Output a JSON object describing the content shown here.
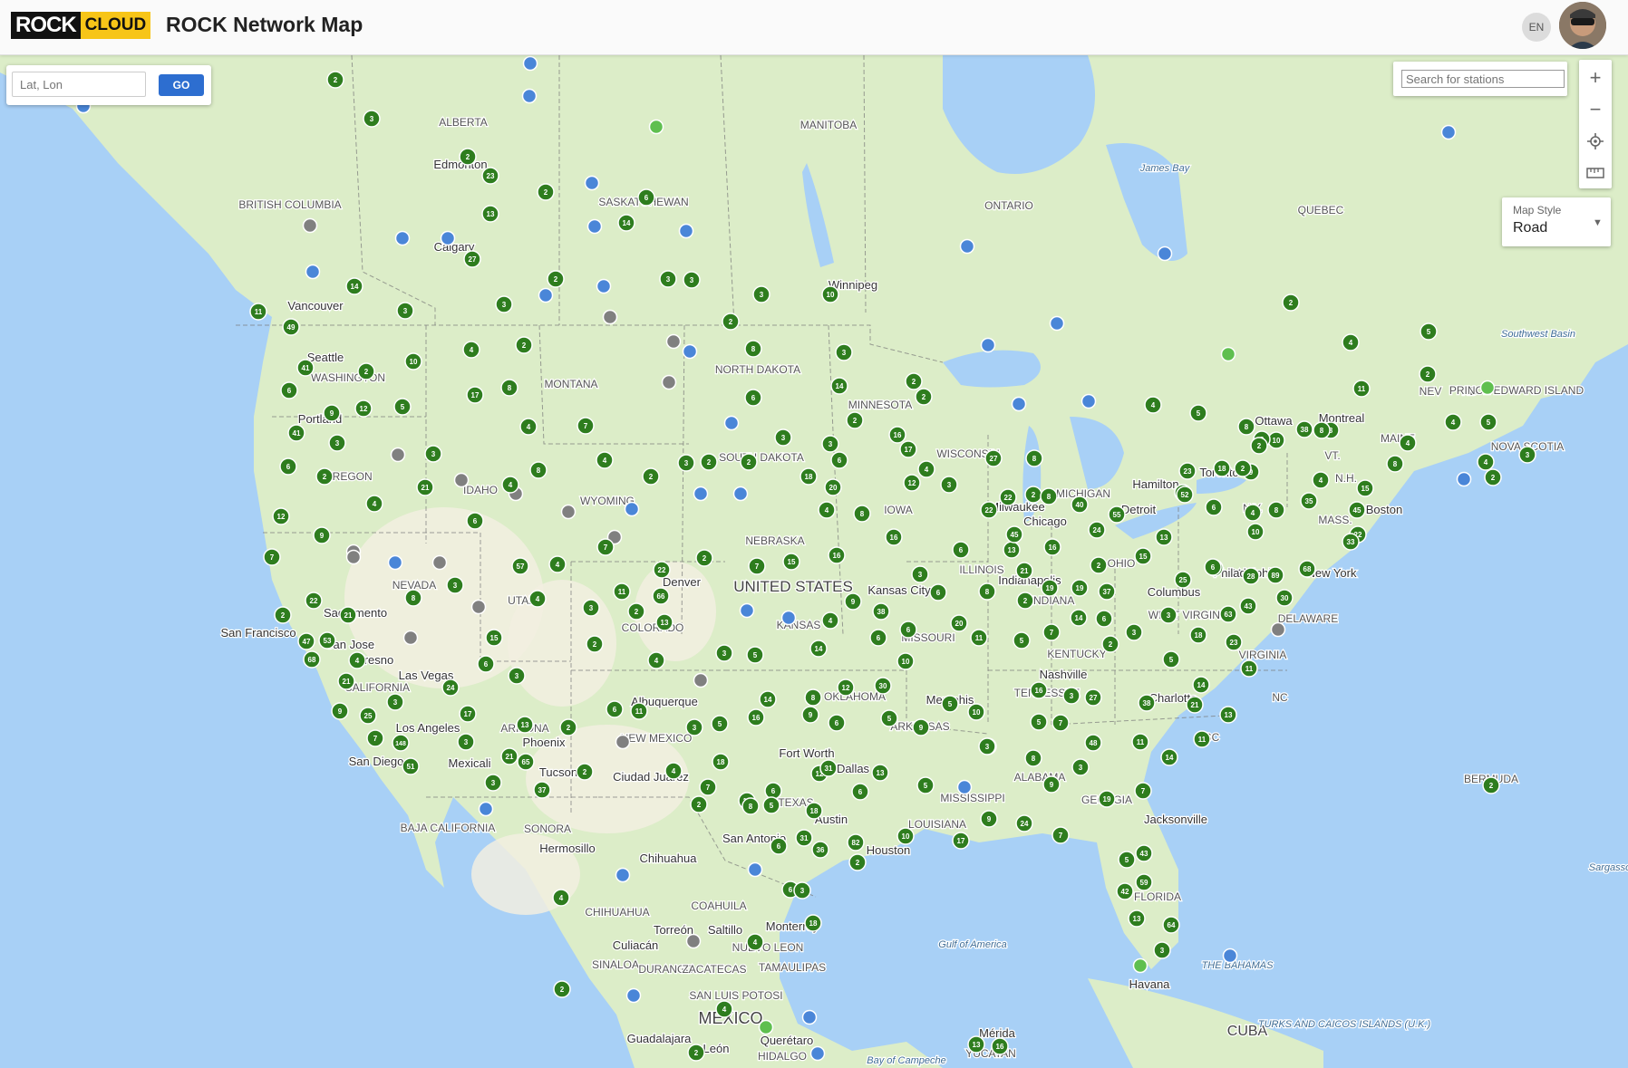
{
  "header": {
    "logo_rock": "ROCK",
    "logo_cloud": "CLOUD",
    "title": "ROCK Network Map",
    "lang": "EN"
  },
  "latlon": {
    "placeholder": "Lat, Lon",
    "go_label": "GO"
  },
  "search": {
    "placeholder": "Search for stations"
  },
  "zoom": {
    "in_label": "+",
    "out_label": "−"
  },
  "map_style": {
    "label": "Map Style",
    "value": "Road"
  },
  "colors": {
    "land": "#dcedc8",
    "land_dark": "#c8e6b0",
    "desert": "#f2efe0",
    "water": "#a8d0f6",
    "cluster": "#2e7d1e",
    "station_blue": "#4a86d8",
    "station_gray": "#808080",
    "station_green": "#5fbf4f"
  },
  "labels": {
    "countries": [
      "UNITED STATES",
      "MEXICO",
      "CUBA"
    ],
    "provinces": [
      "ALBERTA",
      "MANITOBA",
      "SASKATCHEWAN",
      "BRITISH COLUMBIA",
      "ONTARIO",
      "QUEBEC",
      "NB",
      "NEV",
      "PRINCE EDWARD ISLAND",
      "NOVA SCOTIA",
      "WASHINGTON",
      "MONTANA",
      "NORTH DAKOTA",
      "MINNESOTA",
      "OREGON",
      "IDAHO",
      "WYOMING",
      "SOUTH DAKOTA",
      "NEBRASKA",
      "IOWA",
      "WISCONSIN",
      "MICHIGAN",
      "ILLINOIS",
      "INDIANA",
      "OHIO",
      "NEVADA",
      "UTAH",
      "COLORADO",
      "KANSAS",
      "MISSOURI",
      "CALIFORNIA",
      "ARIZONA",
      "NEW MEXICO",
      "OKLAHOMA",
      "ARKANSAS",
      "TENNESSEE",
      "KENTUCKY",
      "VIRGINIA",
      "WEST VIRGINIA",
      "NC",
      "SC",
      "GEORGIA",
      "ALABAMA",
      "MISSISSIPPI",
      "LOUISIANA",
      "TEXAS",
      "FLORIDA",
      "N.Y.",
      "PA",
      "VT.",
      "N.H.",
      "MASS.",
      "MAINE",
      "DELAWARE",
      "BAJA CALIFORNIA",
      "SONORA",
      "CHIHUAHUA",
      "COAHUILA",
      "SINALOA",
      "DURANGO",
      "ZACATECAS",
      "NUEVO LEON",
      "TAMAULIPAS",
      "SAN LUIS POTOSI",
      "HIDALGO",
      "YUCATAN",
      "BERMUDA"
    ],
    "cities": [
      "Edmonton",
      "Calgary",
      "Vancouver",
      "Seattle",
      "Portland",
      "Winnipeg",
      "Ottawa",
      "Montreal",
      "Toronto",
      "Hamilton",
      "Boston",
      "New York",
      "Philadelphia",
      "Chicago",
      "Milwaukee",
      "Detroit",
      "Columbus",
      "Indianapolis",
      "Kansas City",
      "Denver",
      "Nashville",
      "Charlotte",
      "Memphis",
      "Dallas",
      "Fort Worth",
      "Austin",
      "San Antonio",
      "Houston",
      "Jacksonville",
      "Havana",
      "San Francisco",
      "San Jose",
      "Sacramento",
      "Fresno",
      "Las Vegas",
      "Los Angeles",
      "San Diego",
      "Mexicali",
      "Phoenix",
      "Tucson",
      "Albuquerque",
      "Ciudad Juárez",
      "Hermosillo",
      "Chihuahua",
      "Torreón",
      "Culiacán",
      "Saltillo",
      "Monterrey",
      "Querétaro",
      "Guadalajara",
      "León",
      "Mérida"
    ],
    "water": [
      "James Bay",
      "Gulf of America",
      "Bay of Campeche",
      "THE BAHAMAS",
      "TURKS AND CAICOS ISLANDS (U.K.)",
      "Southwest Basin",
      "Sargasso"
    ]
  },
  "clusters": [
    [
      "2",
      370,
      88
    ],
    [
      "3",
      410,
      131
    ],
    [
      "2",
      516,
      173
    ],
    [
      "23",
      541,
      194
    ],
    [
      "13",
      541,
      236
    ],
    [
      "2",
      602,
      212
    ],
    [
      "6",
      713,
      218
    ],
    [
      "14",
      691,
      246
    ],
    [
      "27",
      521,
      286
    ],
    [
      "14",
      391,
      316
    ],
    [
      "11",
      285,
      344
    ],
    [
      "3",
      447,
      343
    ],
    [
      "3",
      556,
      336
    ],
    [
      "2",
      613,
      308
    ],
    [
      "3",
      737,
      308
    ],
    [
      "3",
      763,
      309
    ],
    [
      "3",
      840,
      325
    ],
    [
      "10",
      916,
      325
    ],
    [
      "49",
      321,
      361
    ],
    [
      "41",
      337,
      406
    ],
    [
      "2",
      404,
      410
    ],
    [
      "6",
      319,
      431
    ],
    [
      "10",
      456,
      399
    ],
    [
      "4",
      520,
      386
    ],
    [
      "17",
      524,
      436
    ],
    [
      "8",
      562,
      428
    ],
    [
      "2",
      806,
      355
    ],
    [
      "8",
      831,
      385
    ],
    [
      "3",
      931,
      389
    ],
    [
      "2",
      578,
      381
    ],
    [
      "4",
      583,
      471
    ],
    [
      "7",
      646,
      470
    ],
    [
      "6",
      831,
      439
    ],
    [
      "14",
      926,
      426
    ],
    [
      "2",
      1008,
      421
    ],
    [
      "2",
      1019,
      438
    ],
    [
      "2",
      943,
      464
    ],
    [
      "16",
      990,
      480
    ],
    [
      "17",
      1002,
      496
    ],
    [
      "12",
      1006,
      533
    ],
    [
      "3",
      1047,
      535
    ],
    [
      "4",
      1022,
      518
    ],
    [
      "5",
      444,
      449
    ],
    [
      "12",
      401,
      451
    ],
    [
      "9",
      366,
      456
    ],
    [
      "41",
      327,
      478
    ],
    [
      "3",
      372,
      489
    ],
    [
      "3",
      478,
      501
    ],
    [
      "6",
      318,
      515
    ],
    [
      "2",
      358,
      526
    ],
    [
      "21",
      469,
      538
    ],
    [
      "4",
      413,
      556
    ],
    [
      "4",
      563,
      535
    ],
    [
      "8",
      594,
      519
    ],
    [
      "6",
      524,
      575
    ],
    [
      "2",
      718,
      526
    ],
    [
      "7",
      668,
      604
    ],
    [
      "4",
      667,
      508
    ],
    [
      "3",
      757,
      511
    ],
    [
      "2",
      782,
      510
    ],
    [
      "2",
      826,
      510
    ],
    [
      "3",
      864,
      483
    ],
    [
      "18",
      892,
      526
    ],
    [
      "3",
      916,
      490
    ],
    [
      "6",
      926,
      508
    ],
    [
      "20",
      919,
      538
    ],
    [
      "4",
      912,
      563
    ],
    [
      "8",
      951,
      567
    ],
    [
      "16",
      986,
      593
    ],
    [
      "12",
      310,
      570
    ],
    [
      "9",
      355,
      591
    ],
    [
      "7",
      300,
      615
    ],
    [
      "57",
      574,
      625
    ],
    [
      "4",
      615,
      623
    ],
    [
      "3",
      502,
      646
    ],
    [
      "8",
      456,
      660
    ],
    [
      "2",
      312,
      679
    ],
    [
      "22",
      346,
      663
    ],
    [
      "21",
      384,
      679
    ],
    [
      "53",
      361,
      707
    ],
    [
      "47",
      338,
      708
    ],
    [
      "68",
      344,
      728
    ],
    [
      "4",
      394,
      729
    ],
    [
      "21",
      382,
      752
    ],
    [
      "3",
      436,
      775
    ],
    [
      "9",
      375,
      785
    ],
    [
      "25",
      406,
      790
    ],
    [
      "7",
      414,
      815
    ],
    [
      "148",
      442,
      820
    ],
    [
      "51",
      453,
      846
    ],
    [
      "4",
      593,
      661
    ],
    [
      "3",
      652,
      671
    ],
    [
      "22",
      730,
      629
    ],
    [
      "11",
      686,
      653
    ],
    [
      "66",
      729,
      658
    ],
    [
      "2",
      702,
      675
    ],
    [
      "13",
      733,
      687
    ],
    [
      "15",
      545,
      704
    ],
    [
      "6",
      536,
      733
    ],
    [
      "2",
      656,
      711
    ],
    [
      "3",
      570,
      746
    ],
    [
      "4",
      724,
      729
    ],
    [
      "2",
      777,
      616
    ],
    [
      "7",
      835,
      625
    ],
    [
      "15",
      873,
      620
    ],
    [
      "16",
      923,
      613
    ],
    [
      "3",
      1015,
      634
    ],
    [
      "6",
      1035,
      654
    ],
    [
      "9",
      941,
      664
    ],
    [
      "38",
      972,
      675
    ],
    [
      "4",
      916,
      685
    ],
    [
      "6",
      1002,
      695
    ],
    [
      "6",
      969,
      704
    ],
    [
      "14",
      903,
      716
    ],
    [
      "10",
      999,
      730
    ],
    [
      "20",
      1058,
      688
    ],
    [
      "11",
      1080,
      704
    ],
    [
      "3",
      799,
      721
    ],
    [
      "5",
      833,
      723
    ],
    [
      "24",
      497,
      759
    ],
    [
      "17",
      516,
      788
    ],
    [
      "13",
      579,
      800
    ],
    [
      "6",
      678,
      783
    ],
    [
      "11",
      705,
      785
    ],
    [
      "2",
      627,
      803
    ],
    [
      "21",
      562,
      835
    ],
    [
      "65",
      580,
      841
    ],
    [
      "3",
      514,
      819
    ],
    [
      "3",
      544,
      864
    ],
    [
      "37",
      598,
      872
    ],
    [
      "2",
      645,
      852
    ],
    [
      "4",
      743,
      851
    ],
    [
      "7",
      781,
      869
    ],
    [
      "18",
      795,
      841
    ],
    [
      "2",
      771,
      888
    ],
    [
      "14",
      847,
      772
    ],
    [
      "16",
      834,
      792
    ],
    [
      "8",
      897,
      770
    ],
    [
      "12",
      933,
      759
    ],
    [
      "9",
      894,
      789
    ],
    [
      "6",
      923,
      798
    ],
    [
      "30",
      974,
      757
    ],
    [
      "5",
      1048,
      777
    ],
    [
      "5",
      981,
      793
    ],
    [
      "9",
      1016,
      803
    ],
    [
      "10",
      1077,
      786
    ],
    [
      "3",
      1090,
      824
    ],
    [
      "5",
      794,
      799
    ],
    [
      "3",
      766,
      803
    ],
    [
      "12",
      824,
      884
    ],
    [
      "6",
      853,
      873
    ],
    [
      "5",
      851,
      889
    ],
    [
      "12",
      904,
      854
    ],
    [
      "31",
      914,
      848
    ],
    [
      "18",
      898,
      895
    ],
    [
      "13",
      971,
      853
    ],
    [
      "6",
      949,
      874
    ],
    [
      "5",
      1021,
      867
    ],
    [
      "2",
      1140,
      546
    ],
    [
      "8",
      1141,
      506
    ],
    [
      "27",
      1096,
      506
    ],
    [
      "22",
      1112,
      549
    ],
    [
      "8",
      1157,
      548
    ],
    [
      "13",
      1116,
      607
    ],
    [
      "45",
      1119,
      590
    ],
    [
      "22",
      1091,
      563
    ],
    [
      "6",
      1060,
      607
    ],
    [
      "8",
      1089,
      653
    ],
    [
      "21",
      1130,
      630
    ],
    [
      "2",
      1131,
      663
    ],
    [
      "19",
      1158,
      649
    ],
    [
      "19",
      1191,
      649
    ],
    [
      "40",
      1191,
      557
    ],
    [
      "55",
      1232,
      568
    ],
    [
      "24",
      1210,
      585
    ],
    [
      "16",
      1161,
      604
    ],
    [
      "13",
      1284,
      593
    ],
    [
      "15",
      1261,
      614
    ],
    [
      "2",
      1212,
      624
    ],
    [
      "37",
      1221,
      653
    ],
    [
      "25",
      1305,
      640
    ],
    [
      "8",
      1340,
      627
    ],
    [
      "28",
      1380,
      636
    ],
    [
      "89",
      1407,
      635
    ],
    [
      "6",
      1218,
      683
    ],
    [
      "7",
      1160,
      698
    ],
    [
      "5",
      1127,
      707
    ],
    [
      "14",
      1190,
      682
    ],
    [
      "2",
      1225,
      711
    ],
    [
      "3",
      1251,
      698
    ],
    [
      "3",
      1289,
      679
    ],
    [
      "18",
      1322,
      701
    ],
    [
      "23",
      1361,
      709
    ],
    [
      "63",
      1355,
      678
    ],
    [
      "43",
      1377,
      669
    ],
    [
      "30",
      1417,
      660
    ],
    [
      "68",
      1442,
      628
    ],
    [
      "5",
      1292,
      728
    ],
    [
      "11",
      1378,
      738
    ],
    [
      "16",
      1146,
      762
    ],
    [
      "3",
      1182,
      768
    ],
    [
      "27",
      1206,
      770
    ],
    [
      "38",
      1265,
      776
    ],
    [
      "21",
      1318,
      778
    ],
    [
      "14",
      1325,
      756
    ],
    [
      "13",
      1355,
      789
    ],
    [
      "11",
      1258,
      819
    ],
    [
      "11",
      1326,
      816
    ],
    [
      "14",
      1290,
      836
    ],
    [
      "5",
      1146,
      797
    ],
    [
      "7",
      1170,
      798
    ],
    [
      "48",
      1206,
      820
    ],
    [
      "8",
      1140,
      837
    ],
    [
      "3",
      1089,
      824
    ],
    [
      "9",
      1160,
      866
    ],
    [
      "3",
      1192,
      847
    ],
    [
      "7",
      1261,
      873
    ],
    [
      "19",
      1221,
      882
    ],
    [
      "9",
      1091,
      904
    ],
    [
      "24",
      1130,
      909
    ],
    [
      "7",
      1170,
      922
    ],
    [
      "17",
      1060,
      928
    ],
    [
      "10",
      999,
      923
    ],
    [
      "8",
      828,
      890
    ],
    [
      "36",
      905,
      938
    ],
    [
      "82",
      944,
      930
    ],
    [
      "2",
      946,
      952
    ],
    [
      "31",
      887,
      925
    ],
    [
      "6",
      859,
      934
    ],
    [
      "6",
      872,
      982
    ],
    [
      "3",
      885,
      983
    ],
    [
      "18",
      897,
      1019
    ],
    [
      "4",
      833,
      1040
    ],
    [
      "4",
      619,
      991
    ],
    [
      "2",
      620,
      1092
    ],
    [
      "4",
      799,
      1114
    ],
    [
      "2",
      768,
      1162
    ],
    [
      "13",
      1077,
      1153
    ],
    [
      "16",
      1103,
      1155
    ],
    [
      "43",
      1262,
      942
    ],
    [
      "59",
      1262,
      974
    ],
    [
      "42",
      1241,
      984
    ],
    [
      "13",
      1254,
      1014
    ],
    [
      "64",
      1292,
      1021
    ],
    [
      "5",
      1243,
      949
    ],
    [
      "3",
      1282,
      1049
    ],
    [
      "2",
      1645,
      867
    ],
    [
      "22",
      1498,
      590
    ],
    [
      "33",
      1490,
      598
    ],
    [
      "45",
      1497,
      563
    ],
    [
      "35",
      1444,
      553
    ],
    [
      "15",
      1506,
      539
    ],
    [
      "4",
      1457,
      530
    ],
    [
      "8",
      1408,
      563
    ],
    [
      "10",
      1385,
      587
    ],
    [
      "4",
      1382,
      566
    ],
    [
      "6",
      1339,
      560
    ],
    [
      "13",
      1305,
      544
    ],
    [
      "52",
      1307,
      546
    ],
    [
      "23",
      1310,
      520
    ],
    [
      "18",
      1348,
      517
    ],
    [
      "9",
      1380,
      521
    ],
    [
      "8",
      1375,
      471
    ],
    [
      "10",
      1408,
      486
    ],
    [
      "38",
      1439,
      474
    ],
    [
      "8",
      1468,
      475
    ],
    [
      "8",
      1392,
      485
    ],
    [
      "2",
      1389,
      492
    ],
    [
      "11",
      1502,
      429
    ],
    [
      "4",
      1490,
      378
    ],
    [
      "5",
      1576,
      366
    ],
    [
      "2",
      1575,
      413
    ],
    [
      "4",
      1553,
      489
    ],
    [
      "8",
      1539,
      512
    ],
    [
      "4",
      1603,
      466
    ],
    [
      "5",
      1642,
      466
    ],
    [
      "2",
      1647,
      527
    ],
    [
      "4",
      1639,
      510
    ],
    [
      "3",
      1685,
      502
    ],
    [
      "2",
      1424,
      334
    ],
    [
      "4",
      1272,
      447
    ],
    [
      "5",
      1322,
      456
    ],
    [
      "2",
      1371,
      517
    ],
    [
      "6",
      1338,
      626
    ],
    [
      "8",
      1458,
      475
    ]
  ],
  "stations": [
    [
      "b",
      585,
      70
    ],
    [
      "b",
      584,
      106
    ],
    [
      "b",
      92,
      117
    ],
    [
      "b",
      653,
      202
    ],
    [
      "b",
      444,
      263
    ],
    [
      "b",
      494,
      263
    ],
    [
      "b",
      345,
      300
    ],
    [
      "b",
      656,
      250
    ],
    [
      "b",
      757,
      255
    ],
    [
      "b",
      666,
      316
    ],
    [
      "b",
      602,
      326
    ],
    [
      "b",
      761,
      388
    ],
    [
      "b",
      807,
      467
    ],
    [
      "b",
      773,
      545
    ],
    [
      "b",
      817,
      545
    ],
    [
      "b",
      697,
      562
    ],
    [
      "b",
      436,
      621
    ],
    [
      "b",
      824,
      674
    ],
    [
      "b",
      870,
      682
    ],
    [
      "b",
      536,
      893
    ],
    [
      "b",
      1067,
      272
    ],
    [
      "b",
      1285,
      280
    ],
    [
      "b",
      1166,
      357
    ],
    [
      "b",
      1090,
      381
    ],
    [
      "b",
      1124,
      446
    ],
    [
      "b",
      1201,
      443
    ],
    [
      "b",
      1598,
      146
    ],
    [
      "b",
      1615,
      529
    ],
    [
      "b",
      1064,
      869
    ],
    [
      "b",
      1357,
      1055
    ],
    [
      "b",
      687,
      966
    ],
    [
      "b",
      833,
      960
    ],
    [
      "b",
      699,
      1099
    ],
    [
      "b",
      893,
      1123
    ],
    [
      "b",
      902,
      1163
    ],
    [
      "g",
      342,
      249
    ],
    [
      "g",
      673,
      350
    ],
    [
      "g",
      743,
      377
    ],
    [
      "g",
      738,
      422
    ],
    [
      "g",
      439,
      502
    ],
    [
      "g",
      509,
      530
    ],
    [
      "g",
      569,
      545
    ],
    [
      "g",
      678,
      593
    ],
    [
      "g",
      627,
      565
    ],
    [
      "g",
      390,
      609
    ],
    [
      "g",
      485,
      621
    ],
    [
      "g",
      390,
      615
    ],
    [
      "g",
      528,
      670
    ],
    [
      "g",
      453,
      704
    ],
    [
      "g",
      773,
      751
    ],
    [
      "g",
      687,
      819
    ],
    [
      "g",
      765,
      1039
    ],
    [
      "g",
      1410,
      695
    ],
    [
      "r",
      724,
      140
    ],
    [
      "r",
      1355,
      391
    ],
    [
      "r",
      1641,
      428
    ],
    [
      "r",
      1258,
      1066
    ],
    [
      "r",
      845,
      1134
    ]
  ]
}
